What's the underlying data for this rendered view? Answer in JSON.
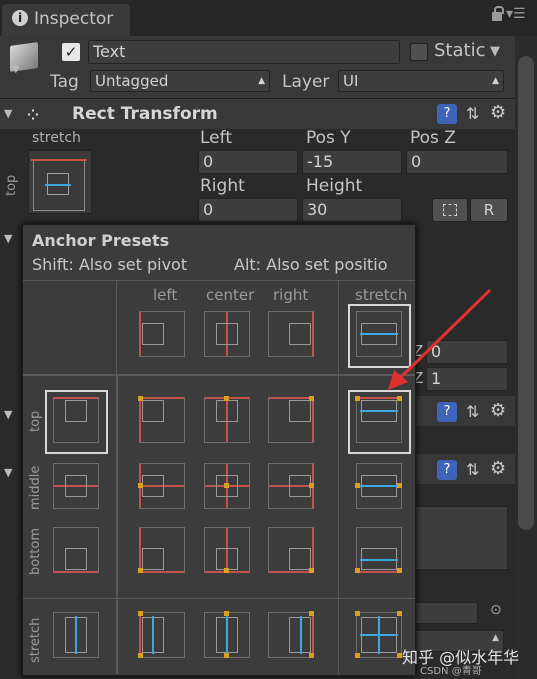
{
  "window": {
    "tab_title": "Inspector"
  },
  "object": {
    "name": "Text",
    "static_label": "Static",
    "tag_label": "Tag",
    "tag_value": "Untagged",
    "layer_label": "Layer",
    "layer_value": "UI"
  },
  "rect_transform": {
    "title": "Rect Transform",
    "anchor_label": "stretch",
    "anchor_side_label": "top",
    "fields": [
      {
        "label": "Left",
        "value": "0"
      },
      {
        "label": "Pos Y",
        "value": "-15"
      },
      {
        "label": "Pos Z",
        "value": "0"
      },
      {
        "label": "Right",
        "value": "0"
      },
      {
        "label": "Height",
        "value": "30"
      }
    ],
    "r_button": "R",
    "behind_z_values": [
      "Z",
      "0",
      "Z",
      "1"
    ]
  },
  "popup": {
    "title": "Anchor Presets",
    "shift_hint": "Shift: Also set pivot",
    "alt_hint": "Alt: Also set positio",
    "col_headers": [
      "left",
      "center",
      "right",
      "stretch"
    ],
    "row_headers": [
      "top",
      "middle",
      "bottom",
      "stretch"
    ]
  },
  "watermark": "知乎 @似水年华",
  "watermark_sub": "CSDN @青哥",
  "colors": {
    "anchor_red": "#c4524a",
    "anchor_blue": "#3aa7e0",
    "anchor_yellow": "#d8a020",
    "arrow": "#e03030"
  }
}
